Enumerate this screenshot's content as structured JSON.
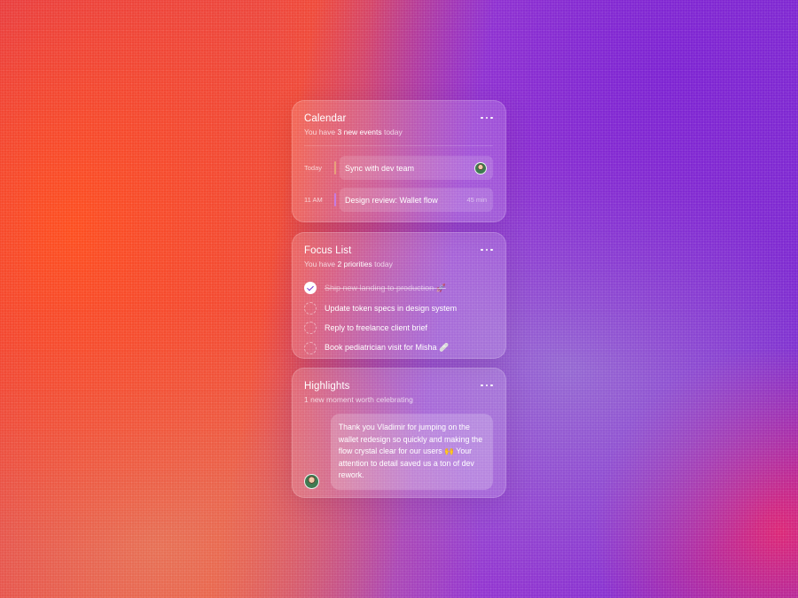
{
  "calendar": {
    "title": "Calendar",
    "subtitle_pre": "You have ",
    "subtitle_highlight": "3 new events",
    "subtitle_post": " today",
    "events": [
      {
        "time": "Today",
        "label": "Sync with dev team",
        "meta": "",
        "bar_color": "#e8a07a"
      },
      {
        "time": "11 AM",
        "label": "Design review: Wallet flow",
        "meta": "45 min",
        "bar_color": "#c77ae0"
      }
    ]
  },
  "focus": {
    "title": "Focus List",
    "subtitle_pre": "You have ",
    "subtitle_highlight": "2 priorities",
    "subtitle_post": " today",
    "tasks": [
      {
        "label": "Ship new landing to production 🚀",
        "done": true
      },
      {
        "label": "Update token specs in design system",
        "done": false
      },
      {
        "label": "Reply to freelance client brief",
        "done": false
      },
      {
        "label": "Book pediatrician visit for Misha 🩹",
        "done": false
      }
    ]
  },
  "highlights": {
    "title": "Highlights",
    "subtitle": "1 new moment worth celebrating",
    "message": "Thank you Vladimir for jumping on the wallet redesign so quickly and making the flow crystal clear for our users 🙌 Your attention to detail saved us a ton of dev rework."
  },
  "icons": {
    "more": "more-horizontal-icon",
    "check": "check-icon"
  }
}
